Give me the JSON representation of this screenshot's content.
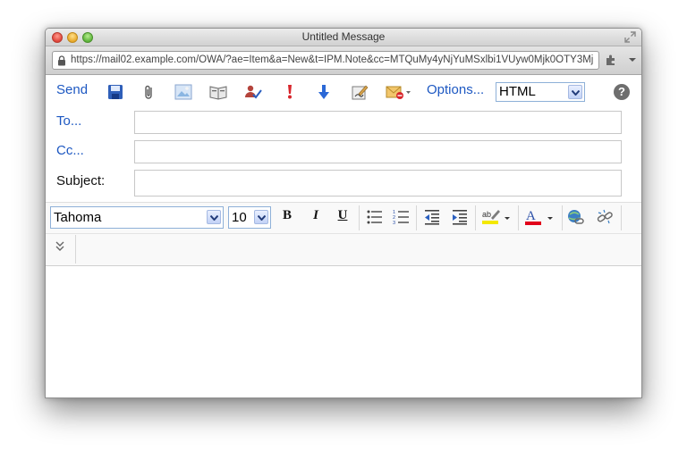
{
  "window": {
    "title": "Untitled Message"
  },
  "browser": {
    "url": "https://mail02.example.com/OWA/?ae=Item&a=New&t=IPM.Note&cc=MTQuMy4yNjYuMSxlbi1VUyw0Mjk0OTY3Mj"
  },
  "toolbar": {
    "send_label": "Send",
    "options_label": "Options...",
    "format_value": "HTML",
    "help_label": "?"
  },
  "fields": {
    "to_label": "To...",
    "cc_label": "Cc...",
    "subject_label": "Subject:",
    "to_value": "",
    "cc_value": "",
    "subject_value": ""
  },
  "format": {
    "font_value": "Tahoma",
    "size_value": "10",
    "bold_label": "B",
    "italic_label": "I",
    "underline_label": "U"
  },
  "colors": {
    "link_blue": "#1d58c2",
    "high_importance_red": "#d8262c",
    "low_importance_blue": "#2b68d6",
    "highlight_yellow": "#f3e800",
    "font_color_red": "#e1001a"
  },
  "icons": [
    "save-icon",
    "attach-icon",
    "insert-image-icon",
    "address-book-icon",
    "check-names-icon",
    "high-importance-icon",
    "low-importance-icon",
    "signature-icon",
    "message-options-icon",
    "bullets-icon",
    "numbering-icon",
    "decrease-indent-icon",
    "increase-indent-icon",
    "highlight-icon",
    "font-color-icon",
    "insert-link-icon",
    "remove-link-icon",
    "expand-toolbar-icon"
  ]
}
